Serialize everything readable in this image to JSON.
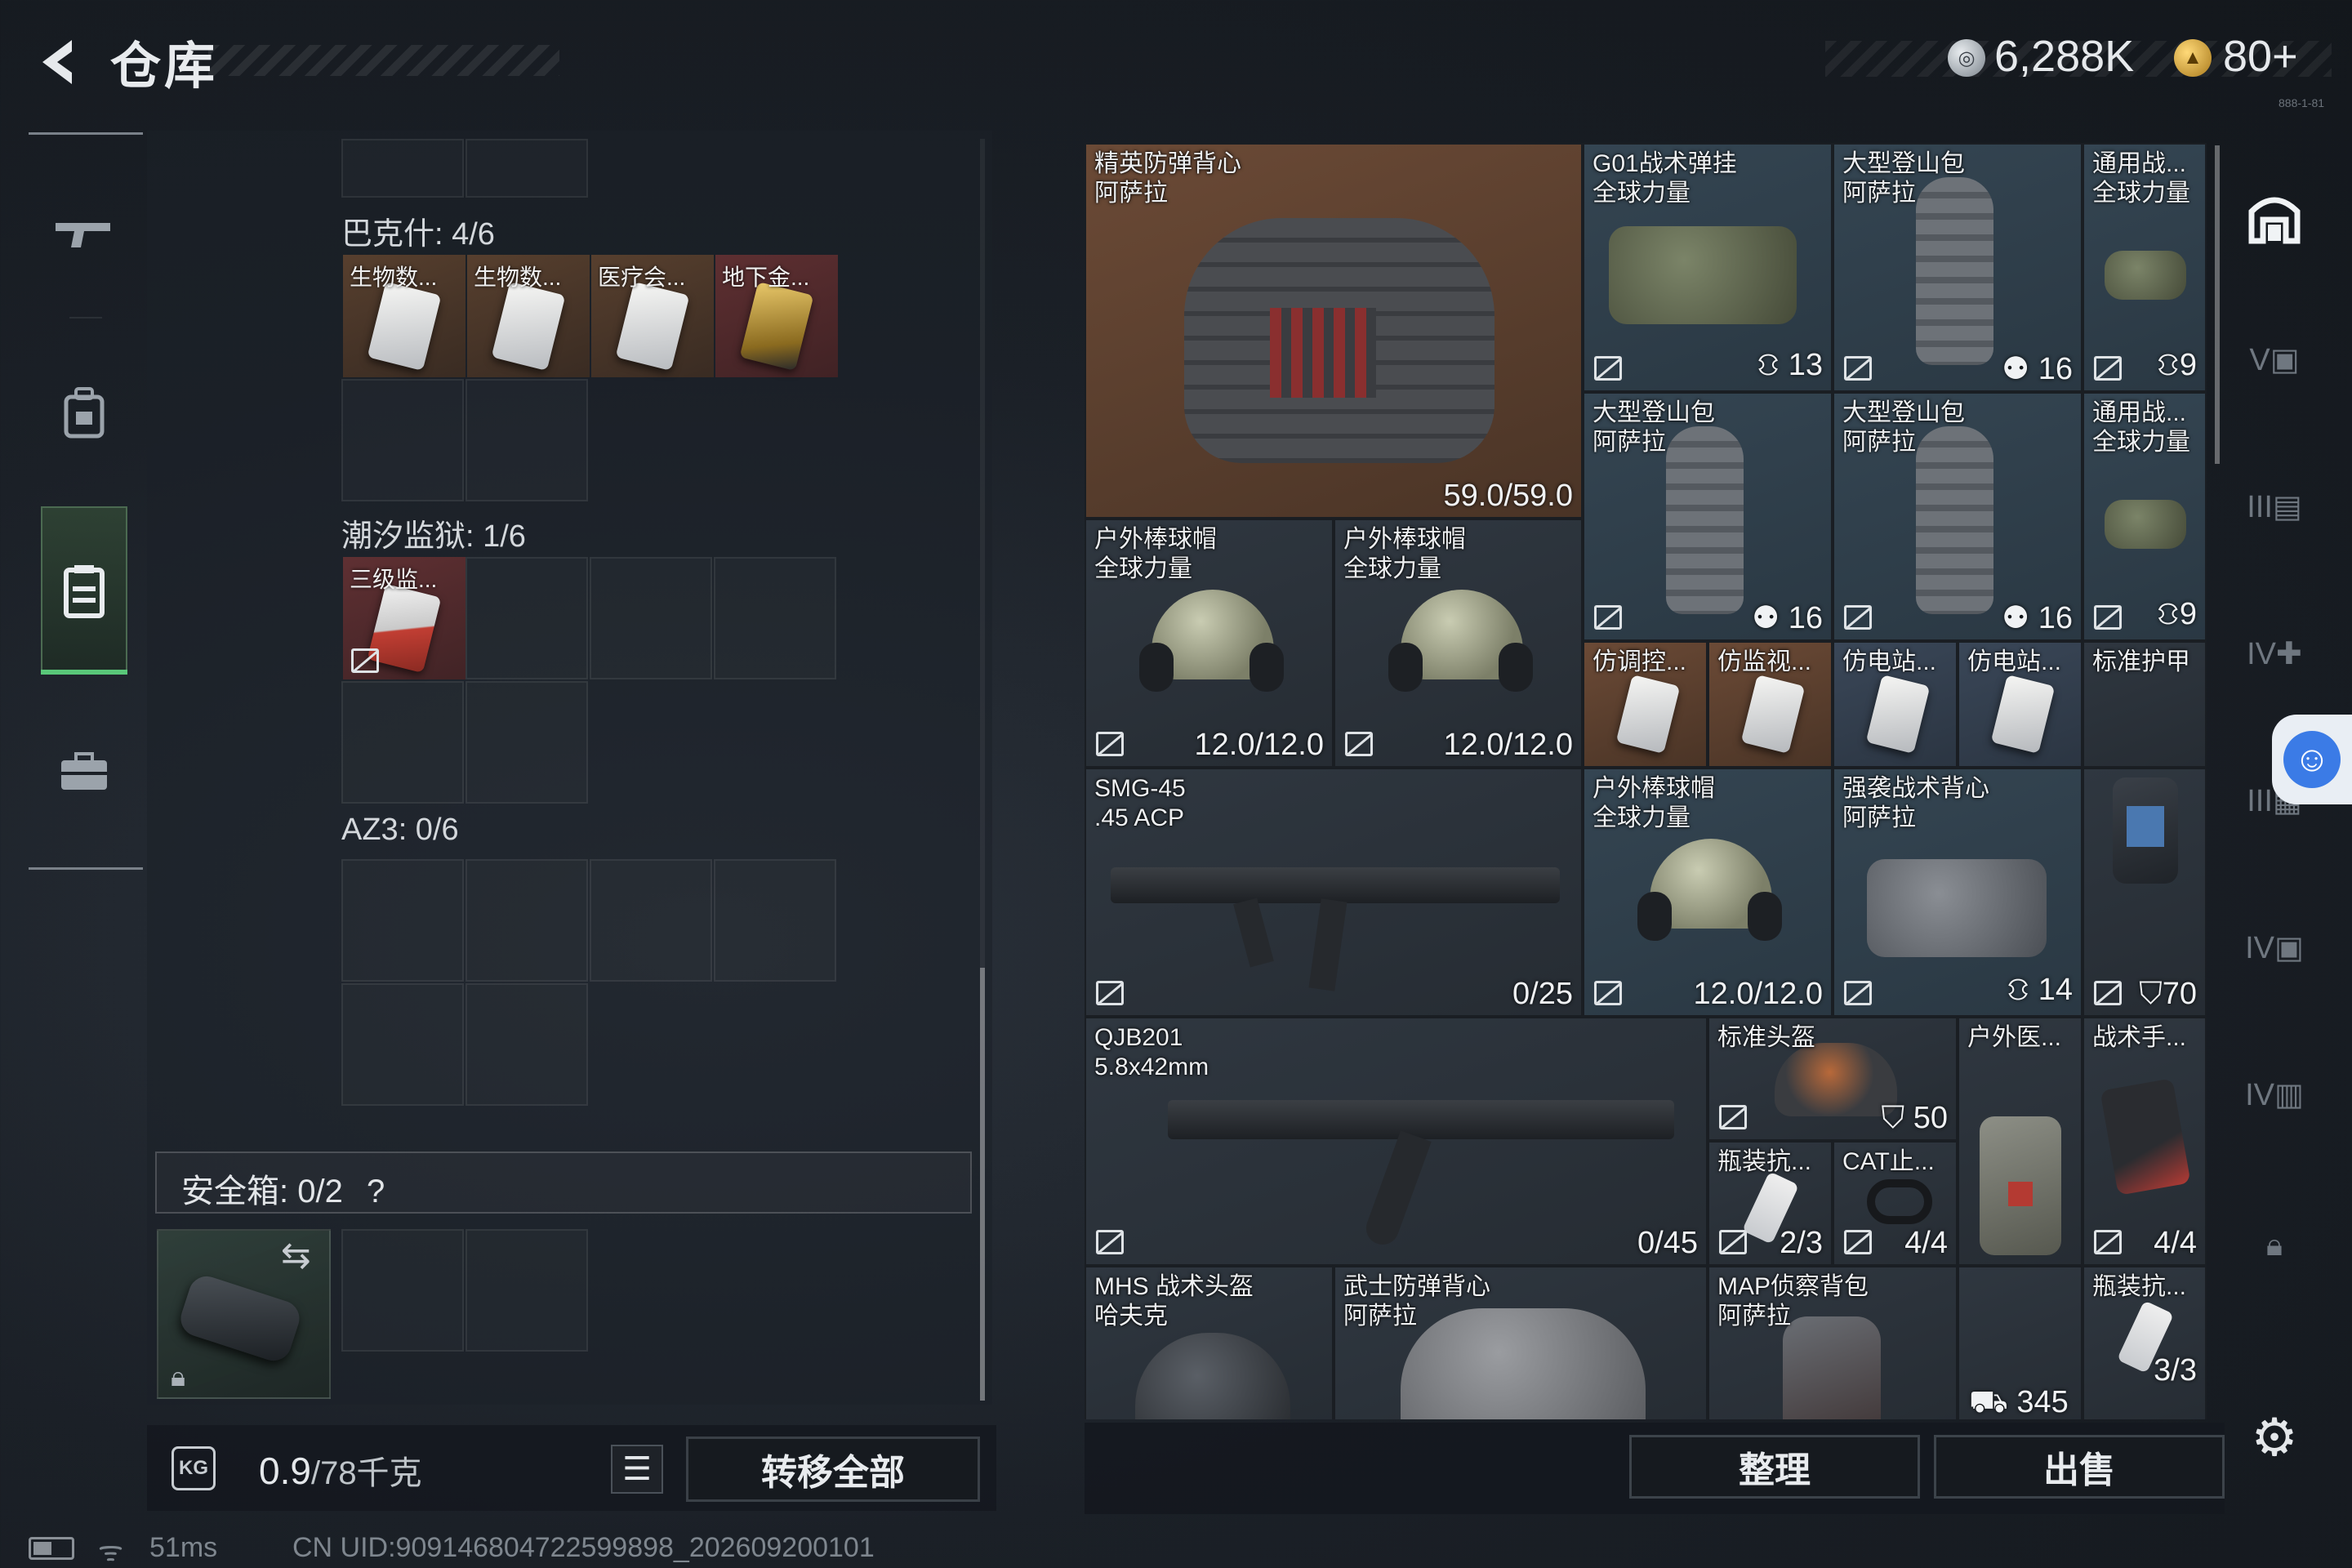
{
  "header": {
    "title": "仓库",
    "silver_amount": "6,288K",
    "gold_amount": "80+",
    "version": "888-1-81"
  },
  "nav": {
    "items": [
      "weapons-icon",
      "backpack-icon",
      "storage-icon",
      "toolbox-icon"
    ],
    "active_index": 2
  },
  "storage": {
    "sections": [
      {
        "title": "巴克什: 4/6",
        "items": [
          "生物数...",
          "生物数...",
          "医疗会...",
          "地下金..."
        ]
      },
      {
        "title": "潮汐监狱: 1/6",
        "items": [
          "三级监..."
        ]
      },
      {
        "title": "AZ3: 0/6",
        "items": []
      }
    ],
    "safe_box_label": "安全箱: 0/2",
    "safe_box_help": "?",
    "weight_value": "0.9",
    "weight_unit": "/78千克",
    "transfer_all": "转移全部"
  },
  "status": {
    "ping": "51ms",
    "uid": "CN UID:909146804722599898_202609200101"
  },
  "inventory": {
    "items": [
      {
        "name": "精英防弹背心\n阿萨拉",
        "value": "59.0/59.0"
      },
      {
        "name": "G01战术弹挂\n全球力量",
        "value": "13"
      },
      {
        "name": "大型登山包\n阿萨拉",
        "value": "16"
      },
      {
        "name": "通用战...\n全球力量",
        "value": "9"
      },
      {
        "name": "大型登山包\n阿萨拉",
        "value": "16"
      },
      {
        "name": "大型登山包\n阿萨拉",
        "value": "16"
      },
      {
        "name": "通用战...\n全球力量",
        "value": "9"
      },
      {
        "name": "户外棒球帽\n全球力量",
        "value": "12.0/12.0"
      },
      {
        "name": "户外棒球帽\n全球力量",
        "value": "12.0/12.0"
      },
      {
        "name": "仿调控...",
        "value": ""
      },
      {
        "name": "仿监视...",
        "value": ""
      },
      {
        "name": "仿电站...",
        "value": ""
      },
      {
        "name": "仿电站...",
        "value": ""
      },
      {
        "name": "标准护甲",
        "value": ""
      },
      {
        "name": "SMG-45\n.45 ACP",
        "value": "0/25"
      },
      {
        "name": "户外棒球帽\n全球力量",
        "value": "12.0/12.0"
      },
      {
        "name": "强袭战术背心\n阿萨拉",
        "value": "14"
      },
      {
        "name": "",
        "value": "70"
      },
      {
        "name": "QJB201\n5.8x42mm",
        "value": "0/45"
      },
      {
        "name": "标准头盔",
        "value": "50"
      },
      {
        "name": "户外医...",
        "value": ""
      },
      {
        "name": "战术手...",
        "value": "4/4"
      },
      {
        "name": "瓶装抗...",
        "value": "2/3"
      },
      {
        "name": "CAT止...",
        "value": "4/4"
      },
      {
        "name": "MHS 战术头盔\n哈夫克",
        "value": ""
      },
      {
        "name": "武士防弹背心\n阿萨拉",
        "value": ""
      },
      {
        "name": "MAP侦察背包\n阿萨拉",
        "value": ""
      },
      {
        "name": "瓶装抗...",
        "value": "3/3"
      }
    ],
    "extra_value": "345",
    "sort_label": "整理",
    "sell_label": "出售"
  },
  "filters": [
    "home-icon",
    "tier5-icon",
    "tier3-icon",
    "tier4-medical-icon",
    "tier3-case-icon",
    "tier4-case-icon",
    "tier4-folder-icon",
    "lock-icon"
  ],
  "colors": {
    "accent_green": "#59c779",
    "item_orange": "#6b4a36",
    "item_blue": "#3a4758",
    "item_red": "#7a3535"
  }
}
